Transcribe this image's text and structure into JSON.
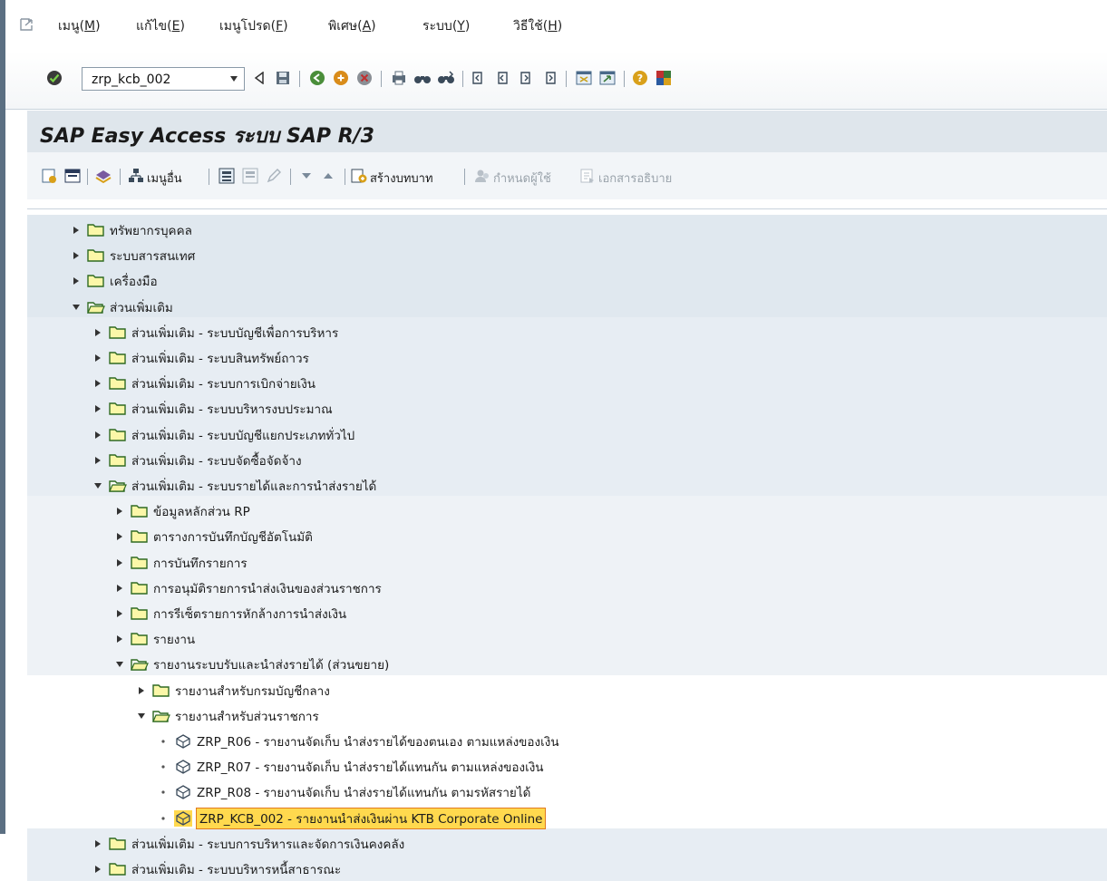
{
  "menubar": {
    "items": [
      {
        "label": "เมนู(",
        "key": "M",
        "tail": ")"
      },
      {
        "label": "แก้ไข(",
        "key": "E",
        "tail": ")"
      },
      {
        "label": "เมนูโปรด(",
        "key": "F",
        "tail": ")"
      },
      {
        "label": "พิเศษ(",
        "key": "A",
        "tail": ")"
      },
      {
        "label": "ระบบ(",
        "key": "Y",
        "tail": ")"
      },
      {
        "label": "วิธีใช้(",
        "key": "H",
        "tail": ")"
      }
    ]
  },
  "systoolbar": {
    "command_value": "zrp_kcb_002"
  },
  "title": "SAP Easy Access  ระบบ SAP R/3",
  "apptoolbar": {
    "other_menu": "เมนูอื่น",
    "create_role": "สร้างบทบาท",
    "assign_user": "กำหนดผู้ใช้",
    "documentation": "เอกสารอธิบาย"
  },
  "tree": [
    {
      "label": "ทรัพยากรบุคคล",
      "level": 0,
      "type": "folder",
      "expanded": false
    },
    {
      "label": "ระบบสารสนเทศ",
      "level": 0,
      "type": "folder",
      "expanded": false
    },
    {
      "label": "เครื่องมือ",
      "level": 0,
      "type": "folder",
      "expanded": false
    },
    {
      "label": "ส่วนเพิ่มเติม",
      "level": 0,
      "type": "folder",
      "expanded": true
    },
    {
      "label": "ส่วนเพิ่มเติม - ระบบบัญชีเพื่อการบริหาร",
      "level": 1,
      "type": "folder",
      "expanded": false
    },
    {
      "label": "ส่วนเพิ่มเติม - ระบบสินทรัพย์ถาวร",
      "level": 1,
      "type": "folder",
      "expanded": false
    },
    {
      "label": "ส่วนเพิ่มเติม - ระบบการเบิกจ่ายเงิน",
      "level": 1,
      "type": "folder",
      "expanded": false
    },
    {
      "label": "ส่วนเพิ่มเติม - ระบบบริหารงบประมาณ",
      "level": 1,
      "type": "folder",
      "expanded": false
    },
    {
      "label": "ส่วนเพิ่มเติม - ระบบบัญชีแยกประเภททั่วไป",
      "level": 1,
      "type": "folder",
      "expanded": false
    },
    {
      "label": "ส่วนเพิ่มเติม - ระบบจัดซื้อจัดจ้าง",
      "level": 1,
      "type": "folder",
      "expanded": false
    },
    {
      "label": "ส่วนเพิ่มเติม - ระบบรายได้และการนำส่งรายได้",
      "level": 1,
      "type": "folder",
      "expanded": true
    },
    {
      "label": "ข้อมูลหลักส่วน RP",
      "level": 2,
      "type": "folder",
      "expanded": false
    },
    {
      "label": "ตารางการบันทึกบัญชีอัตโนมัติ",
      "level": 2,
      "type": "folder",
      "expanded": false
    },
    {
      "label": "การบันทึกรายการ",
      "level": 2,
      "type": "folder",
      "expanded": false
    },
    {
      "label": "การอนุมัติรายการนำส่งเงินของส่วนราชการ",
      "level": 2,
      "type": "folder",
      "expanded": false
    },
    {
      "label": "การรีเซ็ตรายการหักล้างการนำส่งเงิน",
      "level": 2,
      "type": "folder",
      "expanded": false
    },
    {
      "label": "รายงาน",
      "level": 2,
      "type": "folder",
      "expanded": false
    },
    {
      "label": "รายงานระบบรับและนำส่งรายได้ (ส่วนขยาย)",
      "level": 2,
      "type": "folder",
      "expanded": true
    },
    {
      "label": "รายงานสำหรับกรมบัญชีกลาง",
      "level": 3,
      "type": "folder",
      "expanded": false
    },
    {
      "label": "รายงานสำหรับส่วนราชการ",
      "level": 3,
      "type": "folder",
      "expanded": true
    },
    {
      "label": "ZRP_R06 - รายงานจัดเก็บ นำส่งรายได้ของตนเอง ตามแหล่งของเงิน",
      "level": 4,
      "type": "transaction"
    },
    {
      "label": "ZRP_R07 - รายงานจัดเก็บ นำส่งรายได้แทนกัน ตามแหล่งของเงิน",
      "level": 4,
      "type": "transaction"
    },
    {
      "label": "ZRP_R08 - รายงานจัดเก็บ นำส่งรายได้แทนกัน ตามรหัสรายได้",
      "level": 4,
      "type": "transaction"
    },
    {
      "label": "ZRP_KCB_002 - รายงานนำส่งเงินผ่าน KTB Corporate Online",
      "level": 4,
      "type": "transaction",
      "selected": true
    },
    {
      "label": "ส่วนเพิ่มเติม - ระบบการบริหารและจัดการเงินคงคลัง",
      "level": 1,
      "type": "folder",
      "expanded": false
    },
    {
      "label": "ส่วนเพิ่มเติม - ระบบบริหารหนี้สาธารณะ",
      "level": 1,
      "type": "folder",
      "expanded": false
    }
  ]
}
